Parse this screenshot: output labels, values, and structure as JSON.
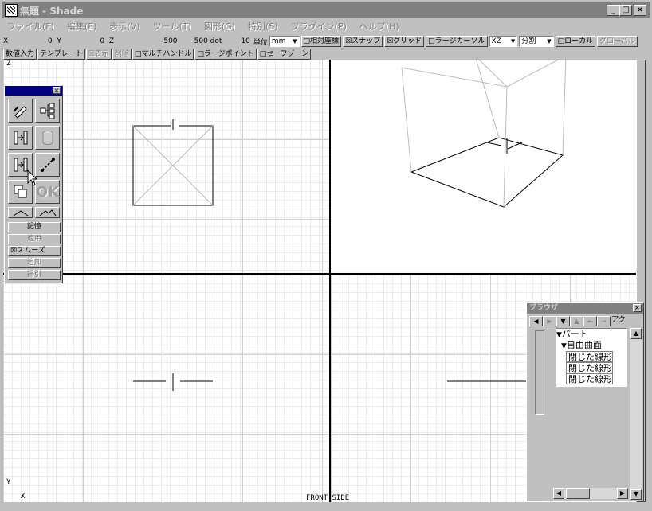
{
  "window": {
    "title": "無題 - Shade",
    "controls": [
      "_",
      "□",
      "×"
    ]
  },
  "menu": [
    "ファイル(F)",
    "編集(E)",
    "表示(V)",
    "ツール(T)",
    "図形(G)",
    "特別(S)",
    "プラグイン(P)",
    "ヘルプ(H)"
  ],
  "coords": {
    "x_label": "X",
    "x_value": "0",
    "y_label": "Y",
    "y_value": "0",
    "z_label": "Z",
    "z_value": "-500",
    "dot_value": "500 dot",
    "unit_num": "10",
    "unit_label": "単位",
    "unit_select": "mm",
    "relative": "□相対座標",
    "snap": "☒スナップ",
    "grid": "☒グリッド",
    "large_cursor": "□ラージカーソル",
    "plane_select": "XZ",
    "split_select": "分割",
    "local": "□ローカル",
    "global": "グローバル"
  },
  "tools": {
    "numeric": "数値入力",
    "template": "テンプレート",
    "show": "☒表示",
    "delete": "削除",
    "multi_handle": "□マルチハンドル",
    "large_point": "□ラージポイント",
    "safe_zone": "□セーフゾーン"
  },
  "toolbox": {
    "close": "×",
    "memory": "記憶",
    "apply": "適用",
    "smooth": "☒スムーズ",
    "add": "追加",
    "pull": "掃引",
    "ok_label": "OK"
  },
  "browser": {
    "title": "ブラウザ",
    "close": "×",
    "extra_tab": "アク",
    "tree": [
      {
        "label": "パート",
        "level": 0
      },
      {
        "label": "自由曲面",
        "level": 1
      },
      {
        "label": "閉じた線形",
        "level": 2
      },
      {
        "label": "閉じた線形",
        "level": 2
      },
      {
        "label": "閉じた線形",
        "level": 2
      }
    ]
  },
  "views": {
    "z_axis": "Z",
    "y_axis": "Y",
    "x_axis": "X",
    "front_side": "FRONT SIDE"
  },
  "colors": {
    "face": "#c0c0c0",
    "title_inactive": "#808080",
    "palette_title": "#000080",
    "grid_line": "#e4e4e4"
  }
}
